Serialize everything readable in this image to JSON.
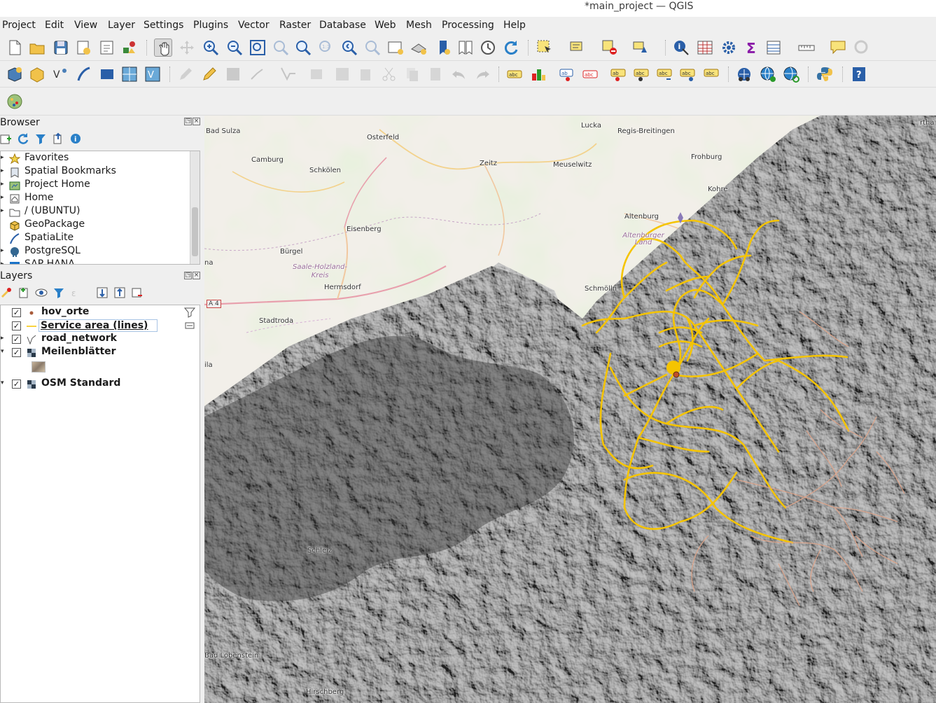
{
  "window": {
    "title": "*main_project — QGIS"
  },
  "menu": [
    {
      "label": "Project",
      "u": "P"
    },
    {
      "label": "Edit",
      "u": "E"
    },
    {
      "label": "View",
      "u": "V"
    },
    {
      "label": "Layer",
      "u": "L"
    },
    {
      "label": "Settings",
      "u": "S"
    },
    {
      "label": "Plugins",
      "u": "P"
    },
    {
      "label": "Vector",
      "u": "o"
    },
    {
      "label": "Raster",
      "u": "R"
    },
    {
      "label": "Database",
      "u": "D"
    },
    {
      "label": "Web",
      "u": "W"
    },
    {
      "label": "Mesh",
      "u": "M"
    },
    {
      "label": "Processing",
      "u": "c"
    },
    {
      "label": "Help",
      "u": "H"
    }
  ],
  "browser": {
    "title": "Browser",
    "items": [
      {
        "label": "Favorites",
        "icon": "star-icon"
      },
      {
        "label": "Spatial Bookmarks",
        "icon": "bookmark-icon"
      },
      {
        "label": "Project Home",
        "icon": "project-home-icon"
      },
      {
        "label": "Home",
        "icon": "home-icon"
      },
      {
        "label": "/ (UBUNTU)",
        "icon": "folder-icon"
      },
      {
        "label": "GeoPackage",
        "icon": "geopackage-icon"
      },
      {
        "label": "SpatiaLite",
        "icon": "spatialite-icon"
      },
      {
        "label": "PostgreSQL",
        "icon": "postgresql-icon"
      },
      {
        "label": "SAP HANA",
        "icon": "saphana-icon"
      }
    ]
  },
  "layers": {
    "title": "Layers",
    "items": [
      {
        "label": "hov_orte",
        "checked": "✓",
        "icon": "point-layer-icon"
      },
      {
        "label": "Service area (lines)",
        "checked": "✓",
        "icon": "line-layer-icon"
      },
      {
        "label": "road_network",
        "checked": "✓",
        "icon": "line-network-icon"
      },
      {
        "label": "Meilenblätter",
        "checked": "✓",
        "icon": "raster-layer-icon"
      },
      {
        "label": "OSM Standard",
        "checked": "✓",
        "icon": "raster-layer-icon"
      }
    ]
  },
  "map": {
    "labels": [
      {
        "text": "Bad Sulza"
      },
      {
        "text": "Osterfeld"
      },
      {
        "text": "Lucka"
      },
      {
        "text": "Regis-Breitingen"
      },
      {
        "text": "Camburg"
      },
      {
        "text": "Schkölen"
      },
      {
        "text": "Zeitz"
      },
      {
        "text": "Meuselwitz"
      },
      {
        "text": "Frohburg"
      },
      {
        "text": "Kohre"
      },
      {
        "text": "Eisenberg"
      },
      {
        "text": "Altenburg"
      },
      {
        "text": "Altenburger Land"
      },
      {
        "text": "Bürgel"
      },
      {
        "text": "Saale-Holzland-Kreis"
      },
      {
        "text": "Hermsdorf"
      },
      {
        "text": "Schmölln"
      },
      {
        "text": "A 4"
      },
      {
        "text": "Stadtroda"
      },
      {
        "text": "Schleiz"
      },
      {
        "text": "Bad Lobenstein"
      },
      {
        "text": "Hirschberg"
      },
      {
        "text": "rtha"
      },
      {
        "text": "na"
      },
      {
        "text": "ila"
      }
    ],
    "colors": {
      "service_area": "#f5c400",
      "road_network": "#e0a58a",
      "hillshade": "#3a3a3a"
    }
  }
}
